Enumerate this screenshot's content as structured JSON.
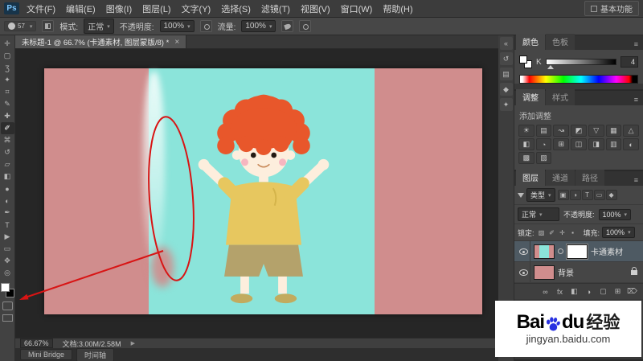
{
  "colors": {
    "annotation_red": "#d81414",
    "artwork_pink": "#d08d8d",
    "artwork_teal": "#8be4da",
    "boy_hair_orange": "#e8572b",
    "boy_shirt_yellow": "#e7c75f",
    "baidu_blue": "#2932e1"
  },
  "glyphs": {
    "close": "×",
    "panel_menu": "≡",
    "status_arrow": "▶"
  },
  "menubar": {
    "logo": "Ps",
    "items": [
      "文件(F)",
      "编辑(E)",
      "图像(I)",
      "图层(L)",
      "文字(Y)",
      "选择(S)",
      "滤镜(T)",
      "视图(V)",
      "窗口(W)",
      "帮助(H)"
    ],
    "workspace": "基本功能"
  },
  "options": {
    "brush_size": "57",
    "mode_label": "模式:",
    "mode_value": "正常",
    "opacity_label": "不透明度:",
    "opacity_value": "100%",
    "flow_label": "流量:",
    "flow_value": "100%"
  },
  "doc_tab": {
    "title": "未标题-1 @ 66.7% (卡通素材, 图层蒙版/8) *"
  },
  "toolbar": {
    "tools": [
      {
        "name": "move-tool",
        "glyph": "✛"
      },
      {
        "name": "marquee-tool",
        "glyph": "▢"
      },
      {
        "name": "lasso-tool",
        "glyph": "Ʒ"
      },
      {
        "name": "quick-selection-tool",
        "glyph": "✦"
      },
      {
        "name": "crop-tool",
        "glyph": "⌗"
      },
      {
        "name": "eyedropper-tool",
        "glyph": "✎"
      },
      {
        "name": "healing-brush-tool",
        "glyph": "✚"
      },
      {
        "name": "brush-tool",
        "glyph": "✐",
        "active": true
      },
      {
        "name": "clone-stamp-tool",
        "glyph": "⌘"
      },
      {
        "name": "history-brush-tool",
        "glyph": "↺"
      },
      {
        "name": "eraser-tool",
        "glyph": "▱"
      },
      {
        "name": "gradient-tool",
        "glyph": "◧"
      },
      {
        "name": "blur-tool",
        "glyph": "●"
      },
      {
        "name": "dodge-tool",
        "glyph": "◐"
      },
      {
        "name": "pen-tool",
        "glyph": "✒"
      },
      {
        "name": "type-tool",
        "glyph": "T"
      },
      {
        "name": "path-selection-tool",
        "glyph": "▶"
      },
      {
        "name": "shape-tool",
        "glyph": "▭"
      },
      {
        "name": "hand-tool",
        "glyph": "✥"
      },
      {
        "name": "zoom-tool",
        "glyph": "◎"
      }
    ]
  },
  "dock": {
    "icons": [
      {
        "name": "collapse-panels-icon",
        "glyph": "«"
      },
      {
        "name": "history-panel-icon",
        "glyph": "↺"
      },
      {
        "name": "properties-panel-icon",
        "glyph": "▤"
      },
      {
        "name": "info-panel-icon",
        "glyph": "◆"
      },
      {
        "name": "navigator-panel-icon",
        "glyph": "✦"
      }
    ]
  },
  "panels": {
    "color": {
      "tabs": [
        "颜色",
        "色板"
      ],
      "channel": "K",
      "value": "4"
    },
    "adjust": {
      "tabs": [
        "调整",
        "样式"
      ],
      "add_label": "添加调整",
      "icons": [
        {
          "name": "brightness-contrast-icon",
          "glyph": "☀"
        },
        {
          "name": "levels-icon",
          "glyph": "▤"
        },
        {
          "name": "curves-icon",
          "glyph": "↝"
        },
        {
          "name": "exposure-icon",
          "glyph": "◩"
        },
        {
          "name": "vibrance-icon",
          "glyph": "▽"
        },
        {
          "name": "hue-saturation-icon",
          "glyph": "▦"
        },
        {
          "name": "color-balance-icon",
          "glyph": "△"
        },
        {
          "name": "black-white-icon",
          "glyph": "◧"
        },
        {
          "name": "photo-filter-icon",
          "glyph": "◔"
        },
        {
          "name": "channel-mixer-icon",
          "glyph": "⊞"
        },
        {
          "name": "color-lookup-icon",
          "glyph": "◫"
        },
        {
          "name": "invert-icon",
          "glyph": "◨"
        },
        {
          "name": "posterize-icon",
          "glyph": "▥"
        },
        {
          "name": "threshold-icon",
          "glyph": "◐"
        },
        {
          "name": "gradient-map-icon",
          "glyph": "▩"
        },
        {
          "name": "selective-color-icon",
          "glyph": "▨"
        }
      ]
    },
    "layers": {
      "tabs": [
        "图层",
        "通道",
        "路径"
      ],
      "filter_label": "类型",
      "filter_icons": [
        {
          "name": "filter-pixel-icon",
          "glyph": "▣"
        },
        {
          "name": "filter-adjustment-icon",
          "glyph": "◑"
        },
        {
          "name": "filter-type-icon",
          "glyph": "T"
        },
        {
          "name": "filter-shape-icon",
          "glyph": "▭"
        },
        {
          "name": "filter-smart-object-icon",
          "glyph": "◆"
        }
      ],
      "blend_mode": "正常",
      "opacity_label": "不透明度:",
      "opacity_value": "100%",
      "lock_label": "锁定:",
      "lock_icons": [
        {
          "name": "lock-transparency-icon",
          "glyph": "▨"
        },
        {
          "name": "lock-pixels-icon",
          "glyph": "✐"
        },
        {
          "name": "lock-position-icon",
          "glyph": "✛"
        },
        {
          "name": "lock-all-icon",
          "glyph": "▪"
        }
      ],
      "fill_label": "填充:",
      "fill_value": "100%",
      "items": [
        {
          "name": "卡通素材"
        },
        {
          "name": "背景"
        }
      ],
      "footer_icons": [
        {
          "name": "link-layers-icon",
          "glyph": "∞"
        },
        {
          "name": "layer-style-icon",
          "glyph": "fx"
        },
        {
          "name": "add-layer-mask-icon",
          "glyph": "◧"
        },
        {
          "name": "new-adjustment-layer-icon",
          "glyph": "◑"
        },
        {
          "name": "new-group-icon",
          "glyph": "▢"
        },
        {
          "name": "new-layer-icon",
          "glyph": "⊞"
        },
        {
          "name": "delete-layer-icon",
          "glyph": "⌦"
        }
      ]
    }
  },
  "statusbar": {
    "zoom": "66.67%",
    "doc_info": "文档:3.00M/2.58M"
  },
  "bottom_tabs": [
    "Mini Bridge",
    "时间轴"
  ],
  "watermark": {
    "logo_bai": "Bai",
    "logo_du": "du",
    "logo_cn": "经验",
    "url": "jingyan.baidu.com"
  }
}
